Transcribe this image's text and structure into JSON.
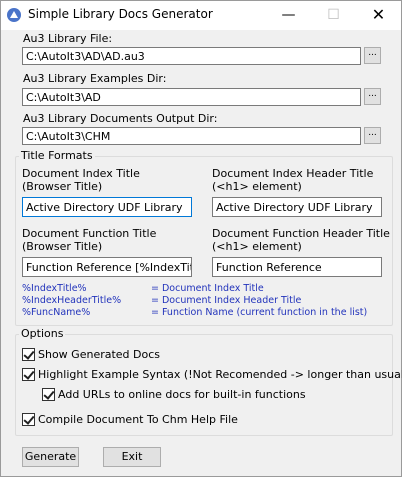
{
  "window": {
    "title": "Simple Library Docs Generator",
    "controls": {
      "minimize": "—",
      "maximize": "☐",
      "close": "✕"
    }
  },
  "paths": {
    "library_file": {
      "label": "Au3 Library File:",
      "value": "C:\\AutoIt3\\AD\\AD.au3"
    },
    "examples_dir": {
      "label": "Au3 Library Examples Dir:",
      "value": "C:\\AutoIt3\\AD"
    },
    "output_dir": {
      "label": "Au3 Library Documents Output Dir:",
      "value": "C:\\AutoIt3\\CHM"
    },
    "browse_label": "..."
  },
  "title_formats": {
    "legend": "Title Formats",
    "doc_index_title": {
      "label1": "Document Index Title",
      "label2": "(Browser Title)",
      "value": "Active Directory UDF Library"
    },
    "doc_index_header": {
      "label1": "Document Index Header Title",
      "label2": "(<h1> element)",
      "value": "Active Directory UDF Library"
    },
    "doc_function_title": {
      "label1": "Document Function Title",
      "label2": "(Browser Title)",
      "value": "Function Reference [%IndexTitle%"
    },
    "doc_function_header": {
      "label1": "Document Function Header Title",
      "label2": "(<h1> element)",
      "value": "Function Reference"
    },
    "hints": [
      {
        "key": "%IndexTitle%",
        "desc": "= Document Index Title"
      },
      {
        "key": "%IndexHeaderTitle%",
        "desc": "= Document Index Header Title"
      },
      {
        "key": "%FuncName%",
        "desc": "= Function Name (current function in the list)"
      }
    ]
  },
  "options": {
    "legend": "Options",
    "items": [
      {
        "label": "Show Generated Docs",
        "checked": true
      },
      {
        "label": "Highlight Example Syntax (!Not Recomended -> longer than usual)",
        "checked": true
      },
      {
        "label": "Add URLs to online docs for built-in functions",
        "checked": true
      },
      {
        "label": "Compile Document To Chm Help File",
        "checked": true
      }
    ]
  },
  "buttons": {
    "generate": "Generate",
    "exit": "Exit"
  },
  "icons": {
    "app": "autoit-app-icon"
  }
}
